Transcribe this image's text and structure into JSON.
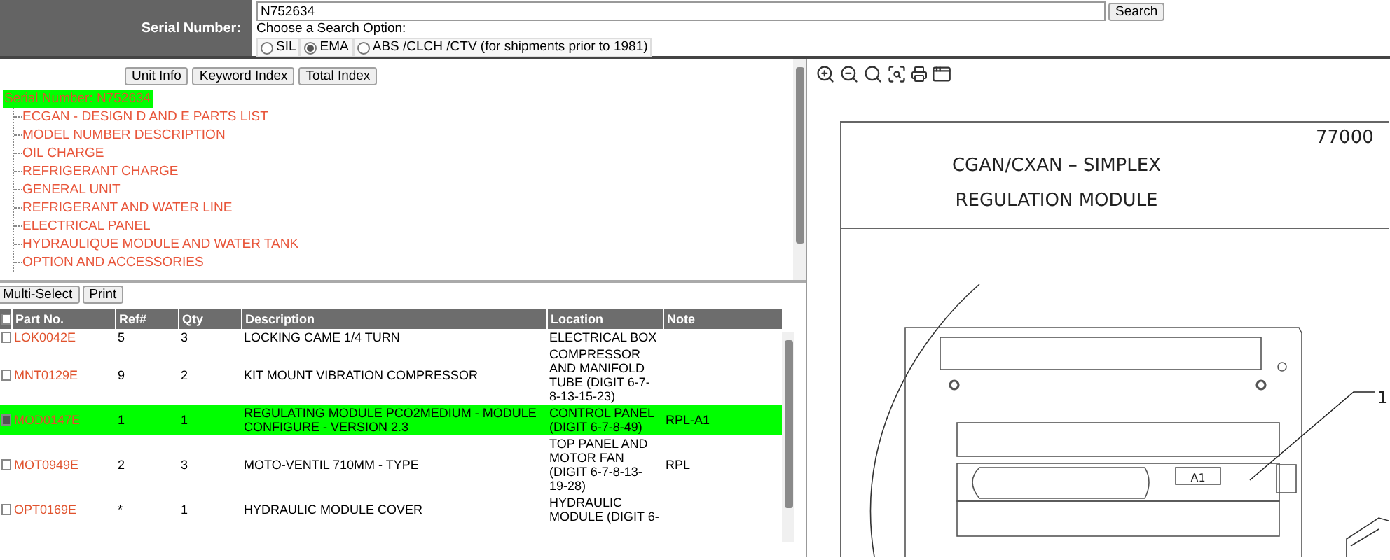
{
  "search": {
    "label": "Serial Number:",
    "value": "N752634",
    "button": "Search",
    "prompt": "Choose a Search Option:",
    "options": [
      {
        "label": "SIL",
        "selected": false
      },
      {
        "label": "EMA",
        "selected": true
      },
      {
        "label": "ABS /CLCH /CTV (for shipments prior to 1981)",
        "selected": false
      }
    ]
  },
  "index_buttons": [
    "Unit Info",
    "Keyword Index",
    "Total Index"
  ],
  "tree": {
    "label": "Serial Number: N752634",
    "selected": true,
    "children": [
      {
        "label": "ECGAN - DESIGN D AND E PARTS LIST"
      },
      {
        "label": "MODEL NUMBER DESCRIPTION"
      },
      {
        "label": "OIL CHARGE"
      },
      {
        "label": "REFRIGERANT CHARGE"
      },
      {
        "label": "GENERAL UNIT"
      },
      {
        "label": "REFRIGERANT AND WATER LINE"
      },
      {
        "label": "ELECTRICAL PANEL"
      },
      {
        "label": "HYDRAULIQUE MODULE AND WATER TANK"
      },
      {
        "label": "OPTION AND ACCESSORIES"
      }
    ]
  },
  "table_buttons": [
    "Multi-Select",
    "Print"
  ],
  "table": {
    "select_all_checked": false,
    "columns": [
      "Part No.",
      "Ref#",
      "Qty",
      "Description",
      "Location",
      "Note"
    ],
    "rows": [
      {
        "part_no": "LOK0042E",
        "ref": "5",
        "qty": "3",
        "description": "LOCKING CAME 1/4 TURN",
        "location": "ELECTRICAL BOX",
        "note": "",
        "checked": false,
        "selected": false
      },
      {
        "part_no": "MNT0129E",
        "ref": "9",
        "qty": "2",
        "description": "KIT MOUNT VIBRATION COMPRESSOR",
        "location": "COMPRESSOR AND MANIFOLD TUBE (DIGIT 6-7-8-13-15-23)",
        "note": "",
        "checked": false,
        "selected": false
      },
      {
        "part_no": "MOD0147E",
        "ref": "1",
        "qty": "1",
        "description": "REGULATING MODULE PCO2MEDIUM - MODULE CONFIGURE - VERSION 2.3",
        "location": "CONTROL PANEL (DIGIT 6-7-8-49)",
        "note": "RPL-A1",
        "checked": true,
        "selected": true
      },
      {
        "part_no": "MOT0949E",
        "ref": "2",
        "qty": "3",
        "description": "MOTO-VENTIL 710MM - TYPE",
        "location": "TOP PANEL AND MOTOR FAN (DIGIT 6-7-8-13-19-28)",
        "note": "RPL",
        "checked": false,
        "selected": false
      },
      {
        "part_no": "OPT0169E",
        "ref": "*",
        "qty": "1",
        "description": "HYDRAULIC MODULE COVER",
        "location": "HYDRAULIC MODULE (DIGIT 6-",
        "note": "",
        "checked": false,
        "selected": false
      }
    ]
  },
  "drawing": {
    "number": "77000",
    "title": "CGAN/CXAN  –  SIMPLEX",
    "subtitle": "REGULATION  MODULE",
    "tag": "A1",
    "callout": "1"
  }
}
